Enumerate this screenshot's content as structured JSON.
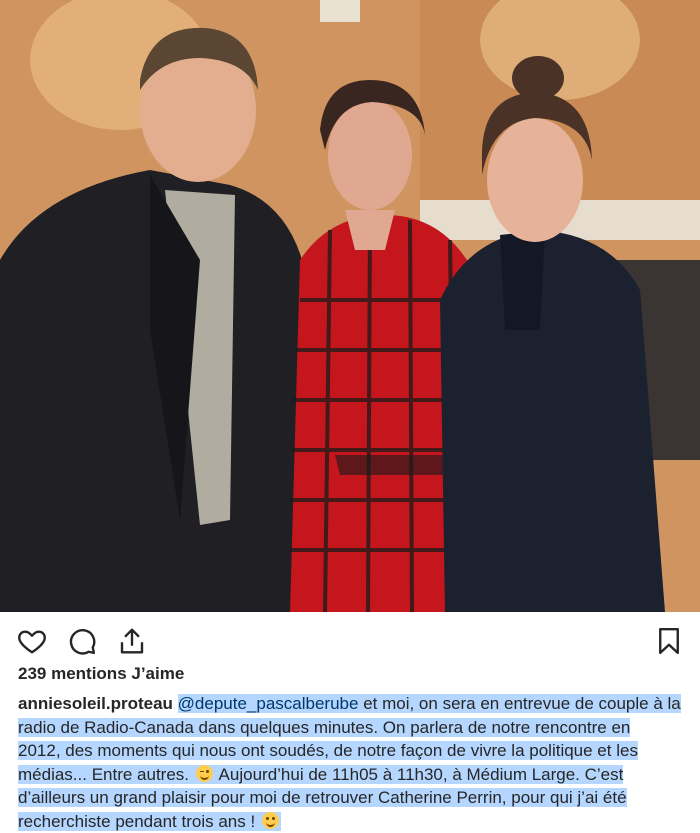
{
  "post": {
    "photo": {
      "icon": "photo-three-people",
      "colors": {
        "wall": "#d9a06a",
        "plaid_red": "#c4161c",
        "suit": "#1f1f24"
      }
    },
    "actions": {
      "like_icon": "heart-icon",
      "comment_icon": "comment-icon",
      "share_icon": "share-icon",
      "save_icon": "bookmark-icon"
    },
    "likes_text": "239 mentions J’aime",
    "caption": {
      "username": "anniesoleil.proteau",
      "mention": "@depute_pascalberube",
      "line1": " et moi, on sera en entrevue de couple à la",
      "line2": "radio de Radio-Canada dans quelques minutes. On parlera de notre rencontre en",
      "line3": "2012, des moments qui nous ont soudés, de notre façon de vivre la politique et les",
      "line4a": "médias... Entre autres.",
      "line4b": " Aujourd’hui de 11h05 à 11h30, à Médium Large. C’est",
      "line5": "d’ailleurs un grand plaisir pour moi de retrouver Catherine Perrin, pour qui j’ai été",
      "line6": "recherchiste pendant trois ans ! ",
      "emoji1": "wink-emoji",
      "emoji2": "smile-emoji"
    }
  }
}
